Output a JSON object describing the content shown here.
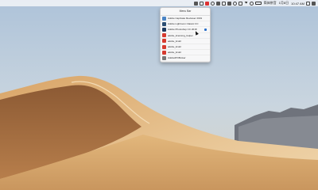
{
  "menubar": {
    "input_source": "简体拼音",
    "date": "1月8日",
    "time": "10:47 AM",
    "icons": [
      "app-icon-1",
      "app-icon-2",
      "app-icon-3",
      "app-icon-4",
      "app-icon-5",
      "app-icon-6",
      "app-icon-7",
      "app-icon-8",
      "app-icon-9",
      "wifi-icon",
      "volume-icon",
      "battery-icon",
      "bluetooth-icon"
    ]
  },
  "panel": {
    "title": "Menu Bar",
    "items": [
      {
        "label": "Adobe Captivate Reviewer 2019",
        "icon_color": "#4b84c4"
      },
      {
        "label": "Adobe Lightroom Classic CC",
        "icon_color": "#2c4e72"
      },
      {
        "label": "Adobe Photoshop CC 2018",
        "icon_color": "#1e3a5f"
      },
      {
        "label": "adobe_licensing_helper",
        "icon_color": "#d63a2f"
      },
      {
        "label": "adobe_licutil",
        "icon_color": "#d63a2f"
      },
      {
        "label": "adobe_licutil",
        "icon_color": "#d63a2f"
      },
      {
        "label": "adobe_licutil",
        "icon_color": "#d63a2f"
      },
      {
        "label": "AdobeIPCBroker",
        "icon_color": "#777777"
      }
    ]
  },
  "colors": {
    "sky_top": "#b7c9dc",
    "sand_light": "#e7c28c",
    "sand_dark": "#9c6438",
    "mountain": "#6e727b"
  }
}
